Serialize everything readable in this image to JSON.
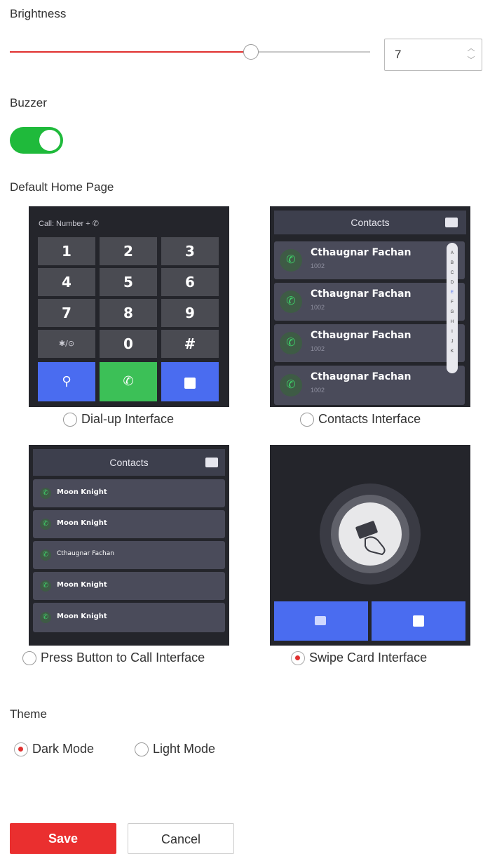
{
  "brightness": {
    "label": "Brightness",
    "value": "7",
    "level_fraction": 0.67
  },
  "buzzer": {
    "label": "Buzzer",
    "enabled": true
  },
  "home_page": {
    "label": "Default Home Page",
    "options": [
      {
        "label": "Dial-up Interface",
        "selected": false
      },
      {
        "label": "Contacts Interface",
        "selected": false
      },
      {
        "label": "Press Button to Call Interface",
        "selected": false
      },
      {
        "label": "Swipe Card Interface",
        "selected": true
      }
    ],
    "dial": {
      "header": "Call:  Number + ✆",
      "keys": [
        "1",
        "2",
        "3",
        "4",
        "5",
        "6",
        "7",
        "8",
        "9",
        "✱/⊙",
        "0",
        "#"
      ]
    },
    "contacts": {
      "title": "Contacts",
      "entries": [
        {
          "name": "Cthaugnar Fachan",
          "number": "1002"
        },
        {
          "name": "Cthaugnar Fachan",
          "number": "1002"
        },
        {
          "name": "Cthaugnar Fachan",
          "number": "1002"
        },
        {
          "name": "Cthaugnar Fachan",
          "number": "1002"
        }
      ],
      "alphabet": [
        "A",
        "B",
        "C",
        "D",
        "E",
        "F",
        "G",
        "H",
        "I",
        "J",
        "K"
      ]
    },
    "press_button": {
      "title": "Contacts",
      "entries": [
        "Moon Knight",
        "Moon Knight",
        "Cthaugnar Fachan",
        "Moon Knight",
        "Moon Knight"
      ]
    }
  },
  "theme": {
    "label": "Theme",
    "options": [
      {
        "label": "Dark Mode",
        "selected": true
      },
      {
        "label": "Light Mode",
        "selected": false
      }
    ]
  },
  "actions": {
    "save": "Save",
    "cancel": "Cancel"
  },
  "colors": {
    "accent": "#ea2f2f",
    "toggle_on": "#1fba3b",
    "key_blue": "#4a6cf0",
    "key_green": "#3cc057",
    "thumb_bg": "#24252b"
  }
}
